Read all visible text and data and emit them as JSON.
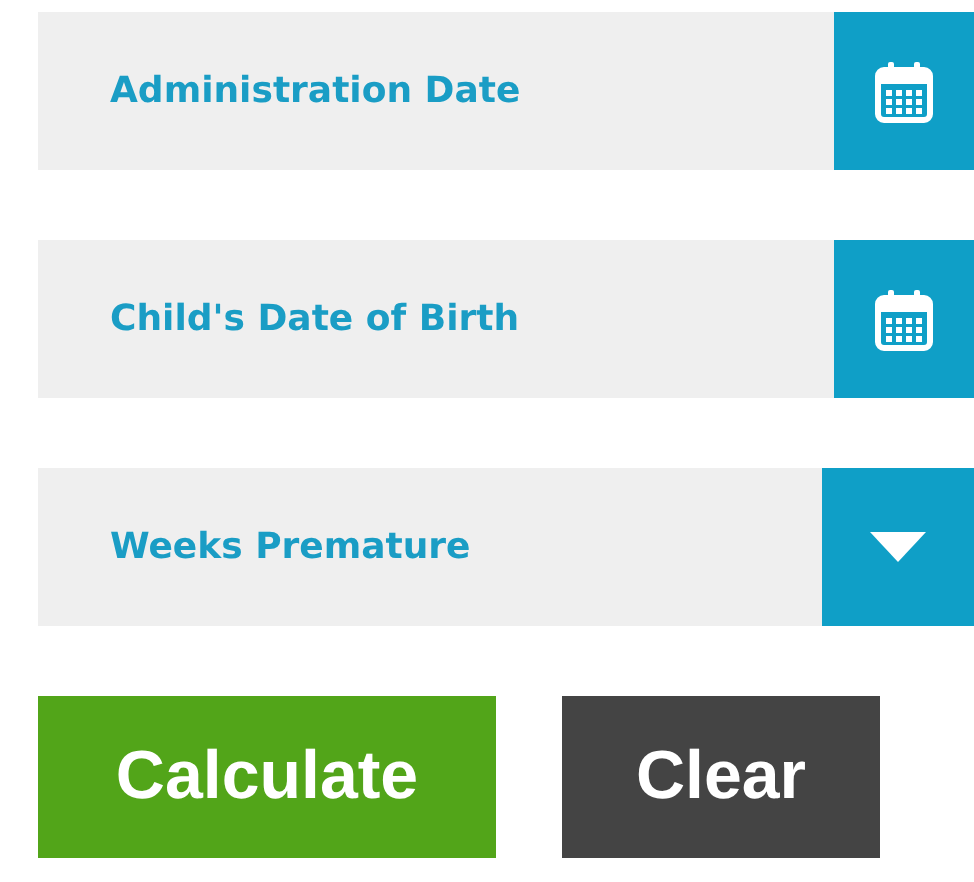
{
  "fields": [
    {
      "kind": "date",
      "placeholder": "Administration Date"
    },
    {
      "kind": "date",
      "placeholder": "Child's Date of Birth"
    },
    {
      "kind": "select",
      "placeholder": "Weeks Premature"
    }
  ],
  "buttons": [
    {
      "kind": "primary",
      "label": "Calculate"
    },
    {
      "kind": "secondary",
      "label": "Clear"
    }
  ]
}
